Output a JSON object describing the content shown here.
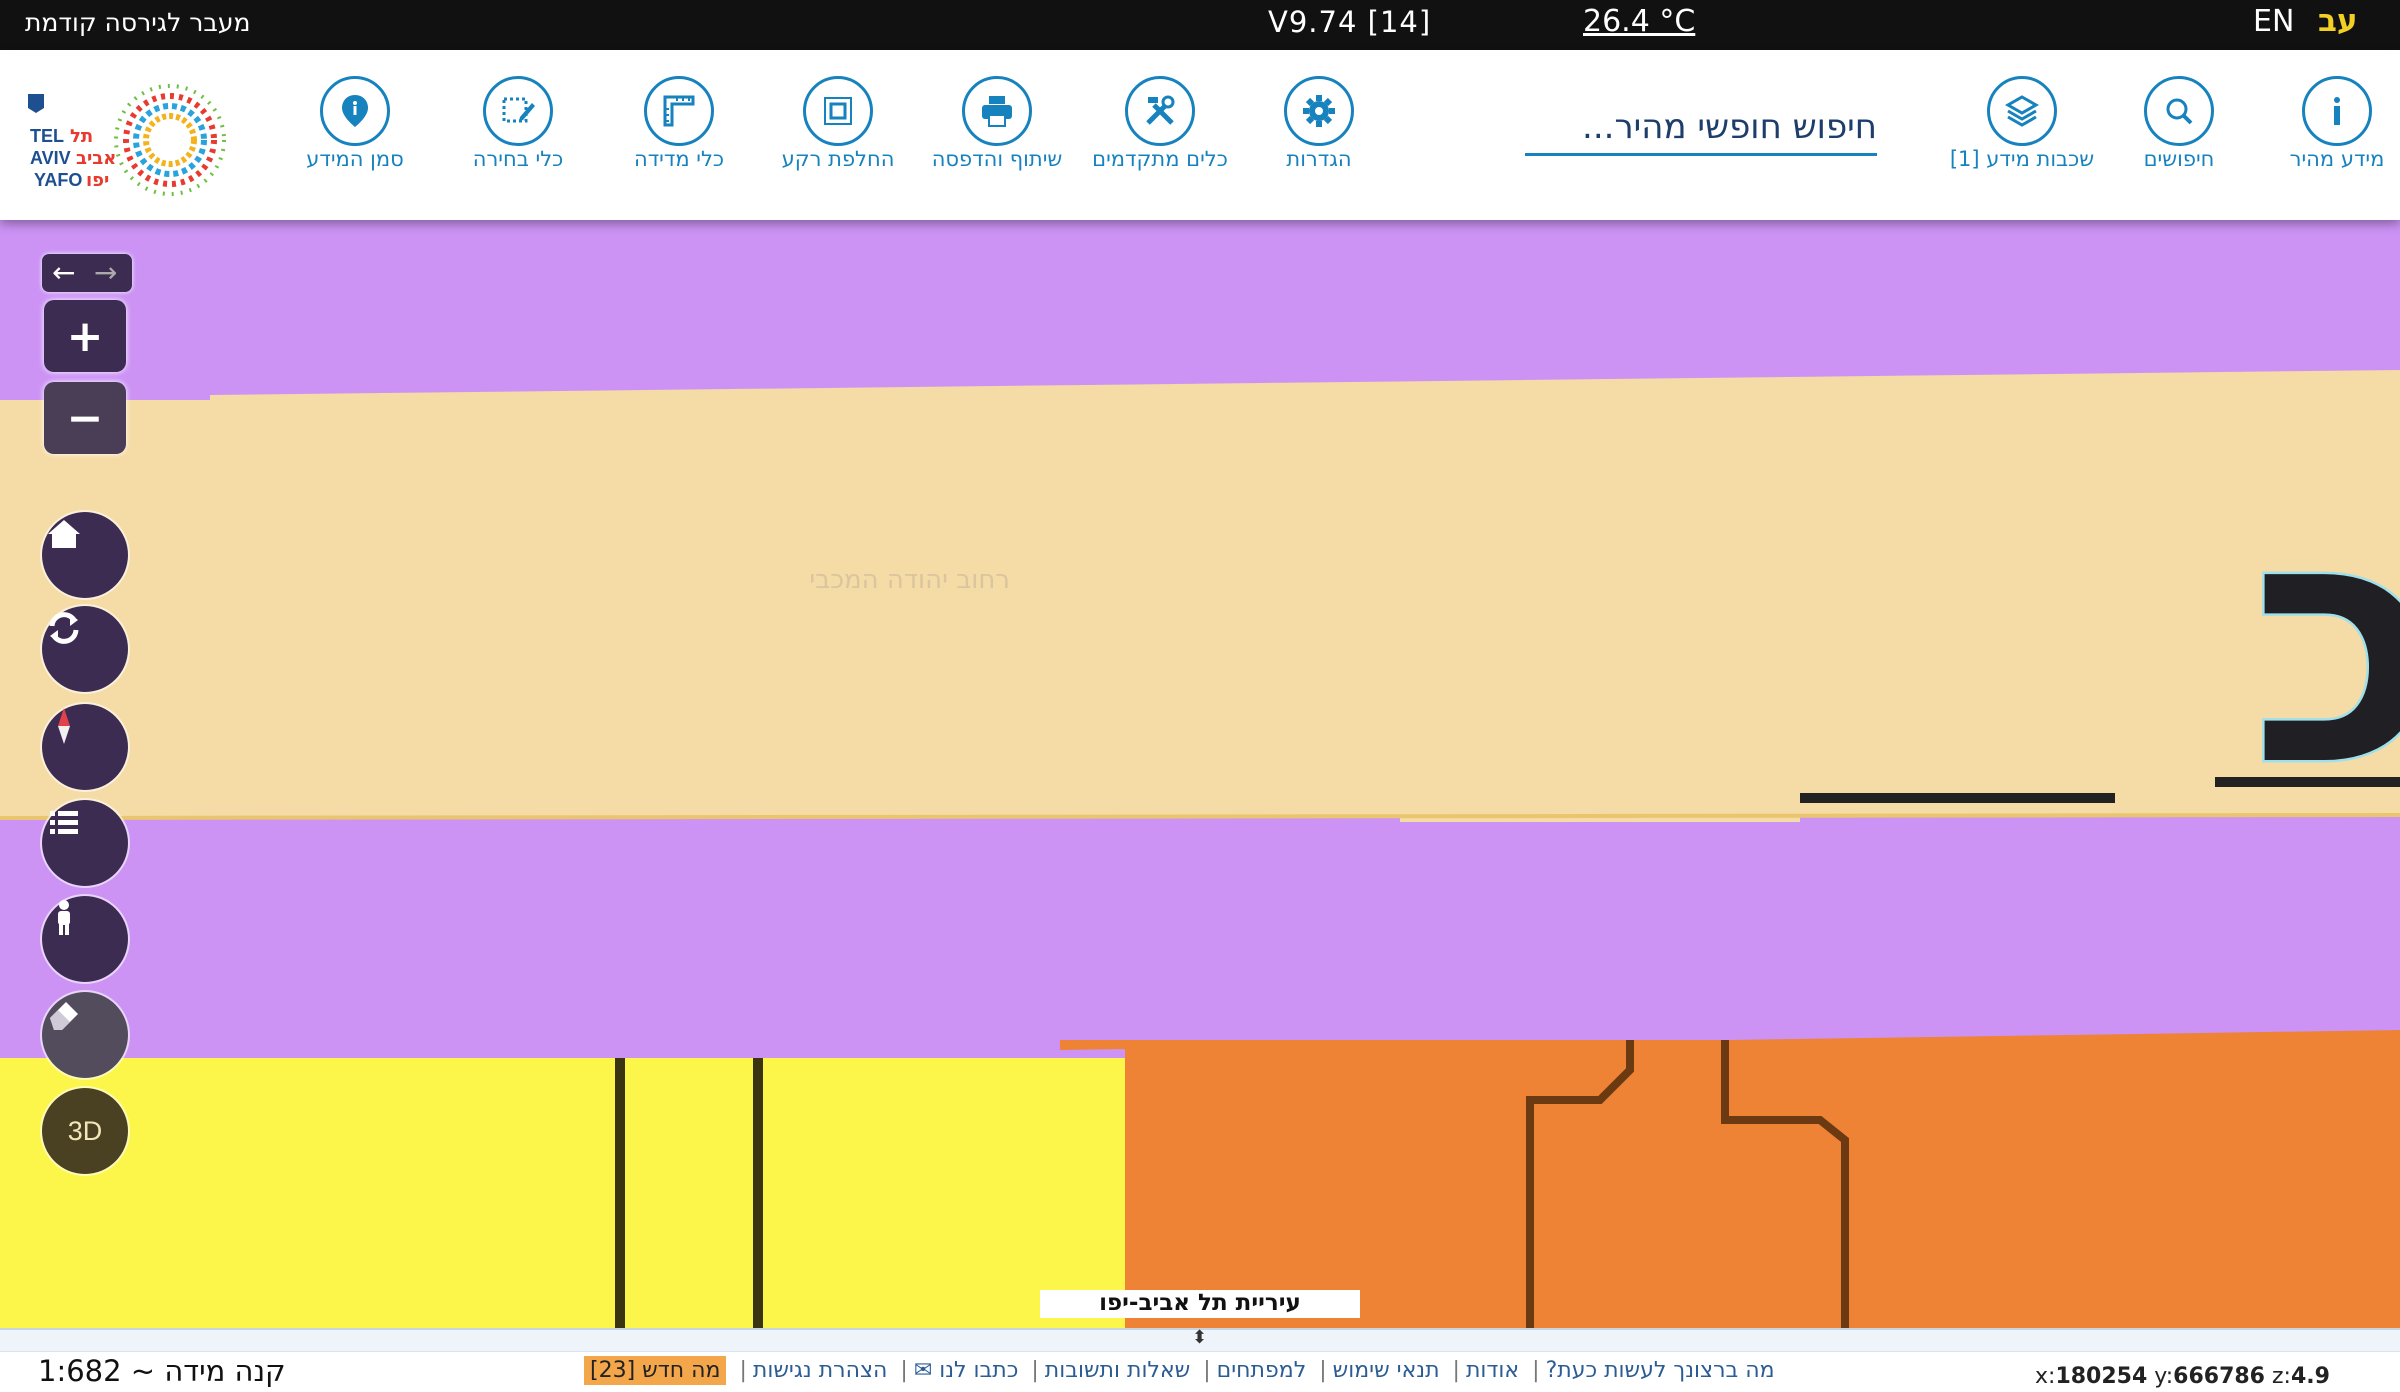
{
  "topbar": {
    "prev_version_link": "מעבר לגירסה קודמת",
    "version": "V9.74 [14]",
    "temperature": "26.4 °C",
    "lang_en": "EN",
    "lang_he": "עב"
  },
  "toolbar": {
    "logo_alt": "TEL AVIV YAFO תל אביב יפו",
    "tools": [
      {
        "label": "סמן המידע",
        "icon": "info-pin-icon"
      },
      {
        "label": "כלי בחירה",
        "icon": "select-edit-icon"
      },
      {
        "label": "כלי מדידה",
        "icon": "ruler-icon"
      },
      {
        "label": "החלפת רקע",
        "icon": "layers-square-icon"
      },
      {
        "label": "שיתוף והדפסה",
        "icon": "printer-icon"
      },
      {
        "label": "כלים מתקדמים",
        "icon": "tools-icon"
      },
      {
        "label": "הגדרות",
        "icon": "gear-icon"
      },
      {
        "label": "שכבות מידע [1]",
        "icon": "layers-stack-icon"
      },
      {
        "label": "חיפושים",
        "icon": "search-icon"
      },
      {
        "label": "מידע מהיר",
        "icon": "info-icon"
      }
    ],
    "search_placeholder": "חיפוש חופשי מהיר..."
  },
  "map": {
    "street_label": "יהודה המכ",
    "faint_label": "רחוב יהודה המכבי",
    "controls": {
      "zoom_in": "+",
      "zoom_out": "−",
      "three_d": "3D",
      "back": "←",
      "forward": "→"
    },
    "colors": {
      "road_purple": "#cc93f5",
      "label_bg": "#f5dba5",
      "yellow_area": "#fdf64a",
      "orange_area": "#ee8336",
      "control_bg": "#3d2c52"
    }
  },
  "caption": "עיריית תל אביב-יפו",
  "footer": {
    "scale": "קנה מידה ~ 1:682",
    "links": [
      "מה ברצונך לעשות כעת?",
      "אודות",
      "תנאי שימוש",
      "למפתחים",
      "שאלות ותשובות",
      "כתבו לנו ✉",
      "הצהרת נגישות"
    ],
    "whats_new": "מה חדש [23]",
    "coords": {
      "x_label": "x:",
      "x": "180254",
      "y_label": "y:",
      "y": "666786",
      "z_label": "z:",
      "z": "4.9"
    }
  }
}
